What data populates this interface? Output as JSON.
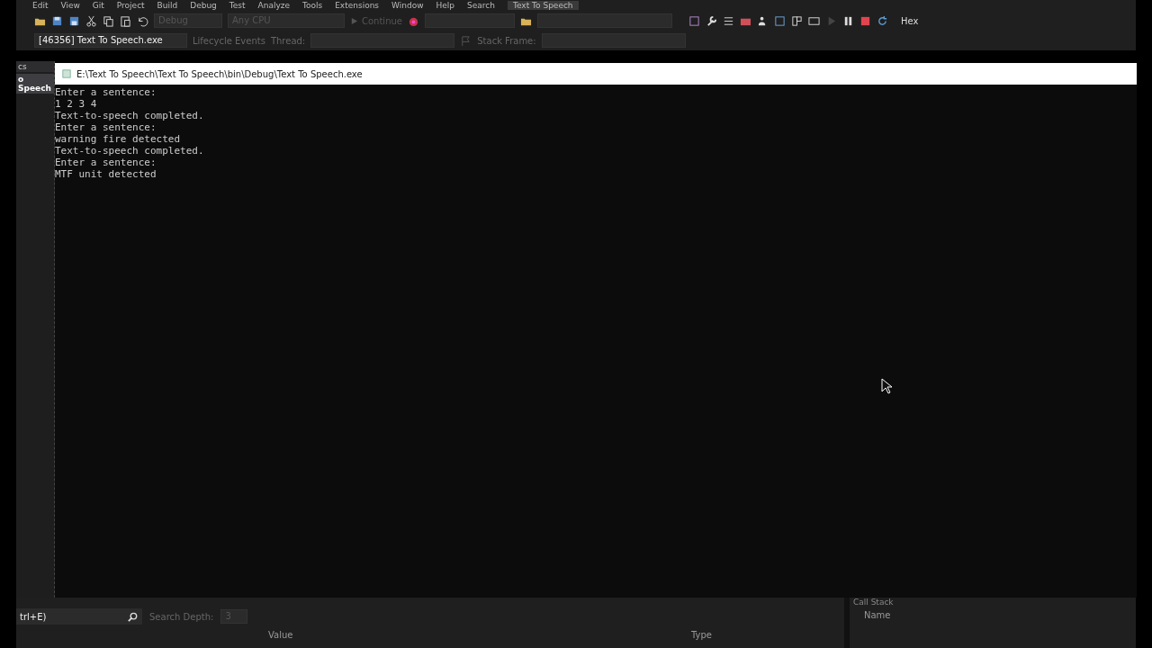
{
  "menu": [
    "Edit",
    "View",
    "Git",
    "Project",
    "Build",
    "Debug",
    "Test",
    "Analyze",
    "Tools",
    "Extensions",
    "Window",
    "Help"
  ],
  "search_label": "Search",
  "solution_title": "Text To Speech",
  "toolbar": {
    "configuration": "Debug",
    "platform": "Any CPU",
    "continue": "Continue",
    "hex": "Hex"
  },
  "debug_location": {
    "process": "[46356] Text To Speech.exe",
    "lifecycle": "Lifecycle Events",
    "thread_label": "Thread:",
    "stack_frame_label": "Stack Frame:"
  },
  "editor_tabs": [
    {
      "label": "cs",
      "selected": false
    },
    {
      "label": "o Speech",
      "selected": true
    }
  ],
  "console": {
    "title": "E:\\Text To Speech\\Text To Speech\\bin\\Debug\\Text To Speech.exe",
    "lines": [
      "Enter a sentence:",
      "1 2 3 4",
      "Text-to-speech completed.",
      "Enter a sentence:",
      "warning fire detected",
      "Text-to-speech completed.",
      "Enter a sentence:",
      "MTF unit detected"
    ]
  },
  "locals": {
    "search_hint": "trl+E)",
    "search_depth_label": "Search Depth:",
    "search_depth": "3",
    "columns": [
      "Value",
      "Type"
    ]
  },
  "call_stack": {
    "title": "Call Stack",
    "columns": [
      "Name"
    ]
  }
}
